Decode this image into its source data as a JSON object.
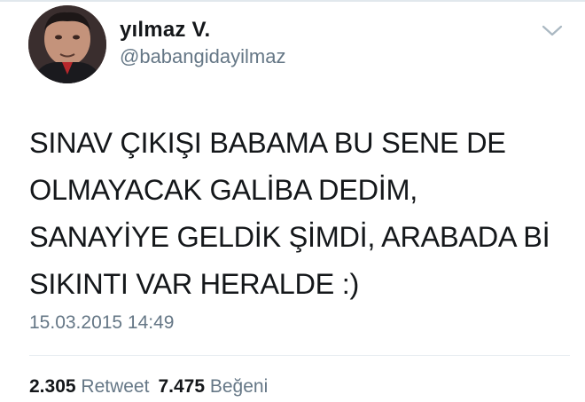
{
  "user": {
    "display_name": "yılmaz V.",
    "handle": "@babangidayilmaz"
  },
  "tweet": {
    "text": "SINAV ÇIKIŞI BABAMA BU SENE DE\nOLMAYACAK GALİBA DEDİM,\nSANAYİYE GELDİK ŞİMDİ, ARABADA Bİ\nSIKINTI VAR HERALDE :)",
    "timestamp": "15.03.2015 14:49"
  },
  "stats": {
    "retweet_count": "2.305",
    "retweet_label": "Retweet",
    "like_count": "7.475",
    "like_label": "Beğeni"
  },
  "icons": {
    "menu": "chevron-down-icon"
  },
  "colors": {
    "text_primary": "#14171a",
    "text_secondary": "#657786",
    "divider": "#e6ecf0"
  }
}
